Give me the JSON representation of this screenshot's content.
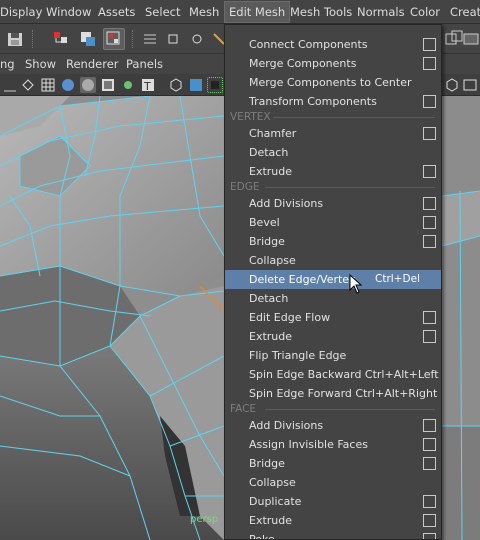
{
  "menubar": {
    "items": [
      {
        "label": "Display"
      },
      {
        "label": "Window"
      },
      {
        "label": "Assets"
      },
      {
        "label": "Select"
      },
      {
        "label": "Mesh"
      },
      {
        "label": "Edit Mesh",
        "active": true
      },
      {
        "label": "Mesh Tools"
      },
      {
        "label": "Normals"
      },
      {
        "label": "Color"
      },
      {
        "label": "Create"
      }
    ]
  },
  "panel_menu": {
    "items": [
      {
        "label": "ng"
      },
      {
        "label": "Show"
      },
      {
        "label": "Renderer"
      },
      {
        "label": "Panels"
      }
    ]
  },
  "viewport": {
    "camera_label": "persp",
    "wire_color": "#5fd3f0",
    "edge_highlight_color": "#e08a30"
  },
  "edit_mesh_menu": {
    "items": [
      {
        "label": "Connect Components",
        "option_box": true
      },
      {
        "label": "Merge Components",
        "option_box": true
      },
      {
        "label": "Merge Components to Center",
        "option_box": false
      },
      {
        "label": "Transform Components",
        "option_box": true
      },
      {
        "section": "VERTEX"
      },
      {
        "label": "Chamfer",
        "option_box": true
      },
      {
        "label": "Detach",
        "option_box": false
      },
      {
        "label": "Extrude",
        "option_box": true
      },
      {
        "section": "EDGE"
      },
      {
        "label": "Add Divisions",
        "option_box": true
      },
      {
        "label": "Bevel",
        "option_box": true
      },
      {
        "label": "Bridge",
        "option_box": true
      },
      {
        "label": "Collapse",
        "option_box": false
      },
      {
        "label": "Delete Edge/Vertex",
        "shortcut": "Ctrl+Del",
        "option_box": false,
        "highlighted": true
      },
      {
        "label": "Detach",
        "option_box": false
      },
      {
        "label": "Edit Edge Flow",
        "option_box": true
      },
      {
        "label": "Extrude",
        "option_box": true
      },
      {
        "label": "Flip Triangle Edge",
        "option_box": false
      },
      {
        "label": "Spin Edge Backward  Ctrl+Alt+Left",
        "option_box": false
      },
      {
        "label": "Spin Edge Forward  Ctrl+Alt+Right",
        "option_box": false
      },
      {
        "section": "FACE"
      },
      {
        "label": "Add Divisions",
        "option_box": true
      },
      {
        "label": "Assign Invisible Faces",
        "option_box": true
      },
      {
        "label": "Bridge",
        "option_box": true
      },
      {
        "label": "Collapse",
        "option_box": false
      },
      {
        "label": "Duplicate",
        "option_box": true
      },
      {
        "label": "Extrude",
        "option_box": true
      },
      {
        "label": "Poke",
        "option_box": true
      }
    ],
    "highlight_color": "#5d7fa8"
  }
}
